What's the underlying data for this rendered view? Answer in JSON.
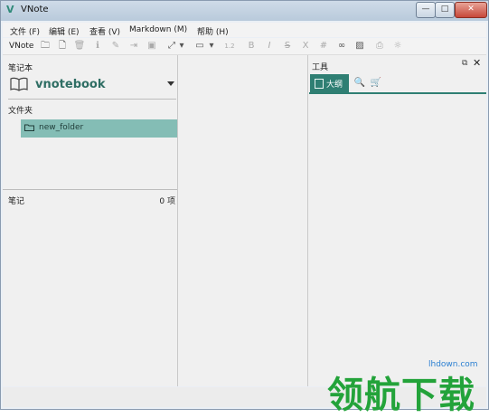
{
  "window": {
    "title": "VNote",
    "logo": "V",
    "buttons": {
      "minimize": "—",
      "maximize": "□",
      "close": "✕"
    }
  },
  "menu": [
    {
      "label": "文件 (F)"
    },
    {
      "label": "编辑 (E)"
    },
    {
      "label": "查看 (V)"
    },
    {
      "label": "Markdown (M)"
    },
    {
      "label": "帮助 (H)"
    }
  ],
  "toolbar": {
    "label": "VNote",
    "icons": [
      "new-folder-icon",
      "new-note-icon",
      "delete-icon",
      "info-icon",
      "edit-icon",
      "export-icon",
      "save-icon",
      "fullscreen-icon",
      "display-icon",
      "heading-icon",
      "bold-icon",
      "italic-icon",
      "strikethrough-icon",
      "inline-code-icon",
      "table-icon",
      "link-icon",
      "image-icon",
      "attachment-icon",
      "lightbulb-icon"
    ],
    "heading_text": "1.2"
  },
  "left_panel": {
    "notebook_label": "笔记本",
    "notebook_name": "vnotebook",
    "folders_label": "文件夹",
    "folders": [
      {
        "name": "new_folder"
      }
    ],
    "notes_label": "笔记",
    "notes_count": "0 项"
  },
  "right_panel": {
    "title": "工具",
    "tabs": [
      {
        "label": "大纲",
        "icon": "outline-icon"
      },
      {
        "icon": "search-icon"
      },
      {
        "icon": "cart-icon"
      }
    ]
  },
  "watermark": {
    "url": "lhdown.com",
    "text": "领航下载"
  },
  "colors": {
    "accent": "#2f7f73",
    "selection": "#84bdb5",
    "notebook_text": "#2f6e64",
    "watermark": "#23a33a"
  }
}
